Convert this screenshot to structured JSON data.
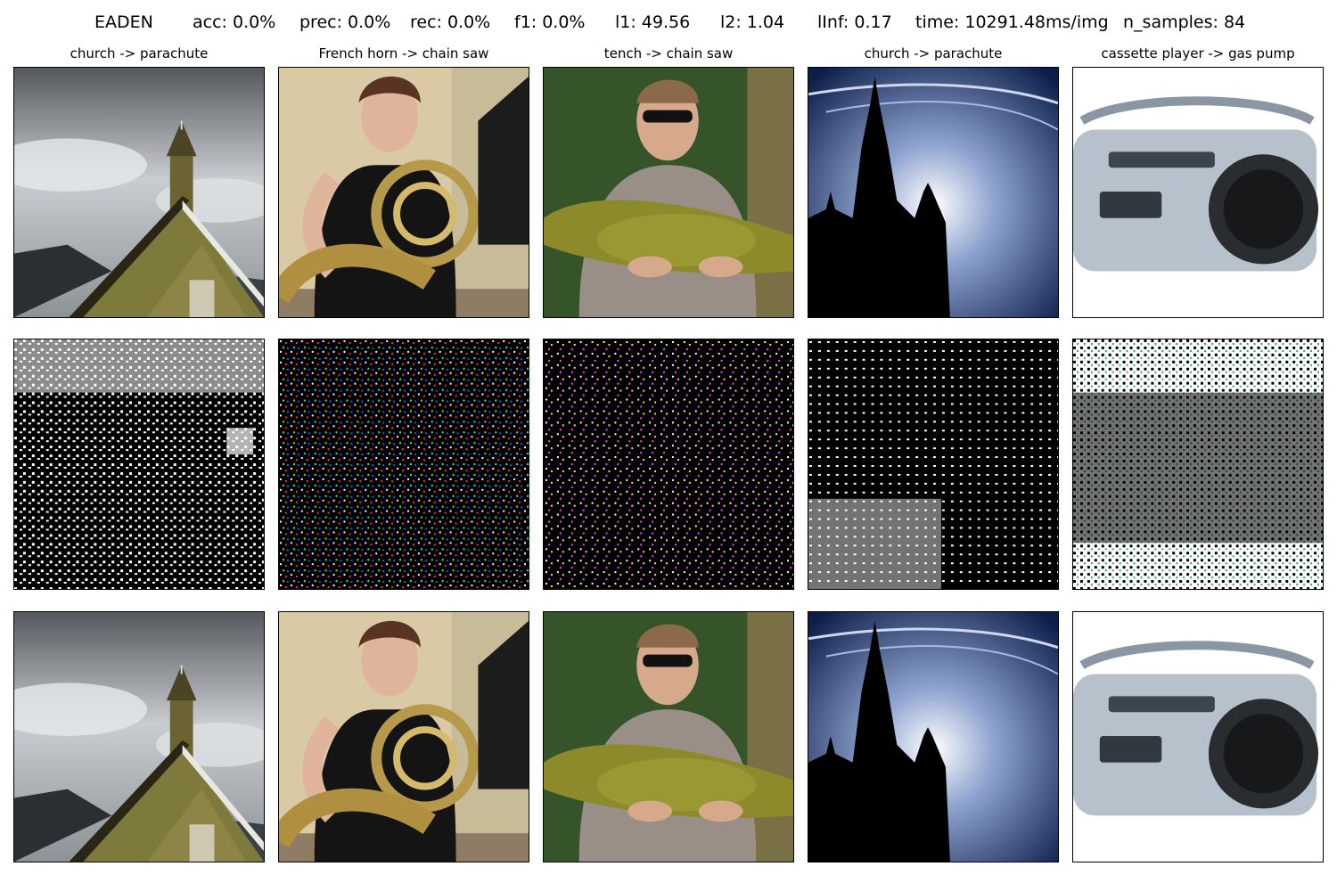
{
  "stats": {
    "method": "EADEN",
    "acc": "acc: 0.0%",
    "prec": "prec: 0.0%",
    "rec": "rec: 0.0%",
    "f1": "f1: 0.0%",
    "l1": "l1: 49.56",
    "l2": "l2: 1.04",
    "linf": "lInf: 0.17",
    "time": "time: 10291.48ms/img",
    "n_samples": "n_samples: 84"
  },
  "columns": [
    {
      "title": "church -> parachute",
      "image": "church-photo"
    },
    {
      "title": "French horn -> chain saw",
      "image": "horn-player-photo"
    },
    {
      "title": "tench -> chain saw",
      "image": "man-holding-fish-photo"
    },
    {
      "title": "church -> parachute",
      "image": "church-silhouette-photo"
    },
    {
      "title": "cassette player -> gas pump",
      "image": "cassette-player-photo"
    }
  ],
  "rows": [
    "original",
    "perturbation",
    "adversarial"
  ],
  "colors": {
    "background": "#ffffff",
    "noise_dark": "#000000",
    "noise_light": "#ffffff"
  }
}
